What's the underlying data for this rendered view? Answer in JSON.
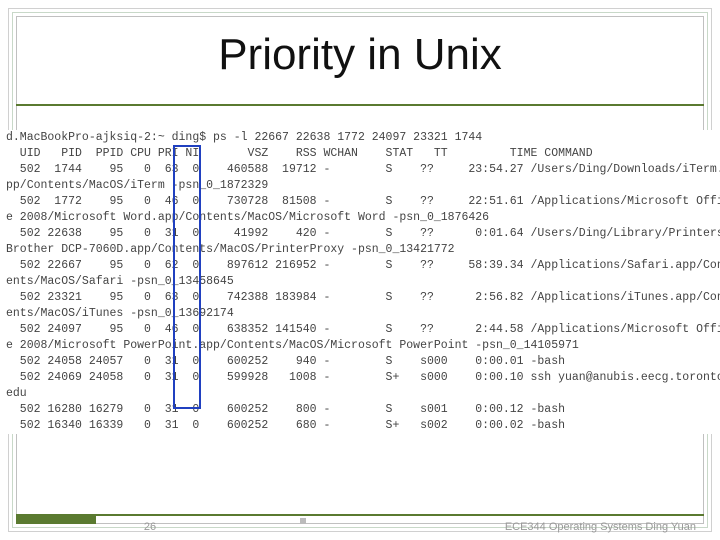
{
  "title": "Priority in Unix",
  "page_number": "26",
  "footer_right": "ECE344 Operating Systems Ding Yuan",
  "terminal": [
    "d.MacBookPro-ajksiq-2:~ ding$ ps -l 22667 22638 1772 24097 23321 1744",
    "  UID   PID  PPID CPU PRI NI       VSZ    RSS WCHAN    STAT   TT         TIME COMMAND",
    "  502  1744    95   0  63  0    460588  19712 -        S    ??     23:54.27 /Users/Ding/Downloads/iTerm.a",
    "pp/Contents/MacOS/iTerm -psn_0_1872329",
    "  502  1772    95   0  46  0    730728  81508 -        S    ??     22:51.61 /Applications/Microsoft Offic",
    "e 2008/Microsoft Word.app/Contents/MacOS/Microsoft Word -psn_0_1876426",
    "  502 22638    95   0  31  0     41992    420 -        S    ??      0:01.64 /Users/Ding/Library/Printers/",
    "Brother DCP-7060D.app/Contents/MacOS/PrinterProxy -psn_0_13421772",
    "  502 22667    95   0  62  0    897612 216952 -        S    ??     58:39.34 /Applications/Safari.app/Cont",
    "ents/MacOS/Safari -psn_0_13458645",
    "  502 23321    95   0  63  0    742388 183984 -        S    ??      2:56.82 /Applications/iTunes.app/Cont",
    "ents/MacOS/iTunes -psn_0_13692174",
    "  502 24097    95   0  46  0    638352 141540 -        S    ??      2:44.58 /Applications/Microsoft Offic",
    "e 2008/Microsoft PowerPoint.app/Contents/MacOS/Microsoft PowerPoint -psn_0_14105971",
    "  502 24058 24057   0  31  0    600252    940 -        S    s000    0:00.01 -bash",
    "  502 24069 24058   0  31  0    599928   1008 -        S+   s000    0:00.10 ssh yuan@anubis.eecg.toronto.",
    "edu",
    "  502 16280 16279   0  31  0    600252    800 -        S    s001    0:00.12 -bash",
    "  502 16340 16339   0  31  0    600252    680 -        S+   s002    0:00.02 -bash"
  ]
}
